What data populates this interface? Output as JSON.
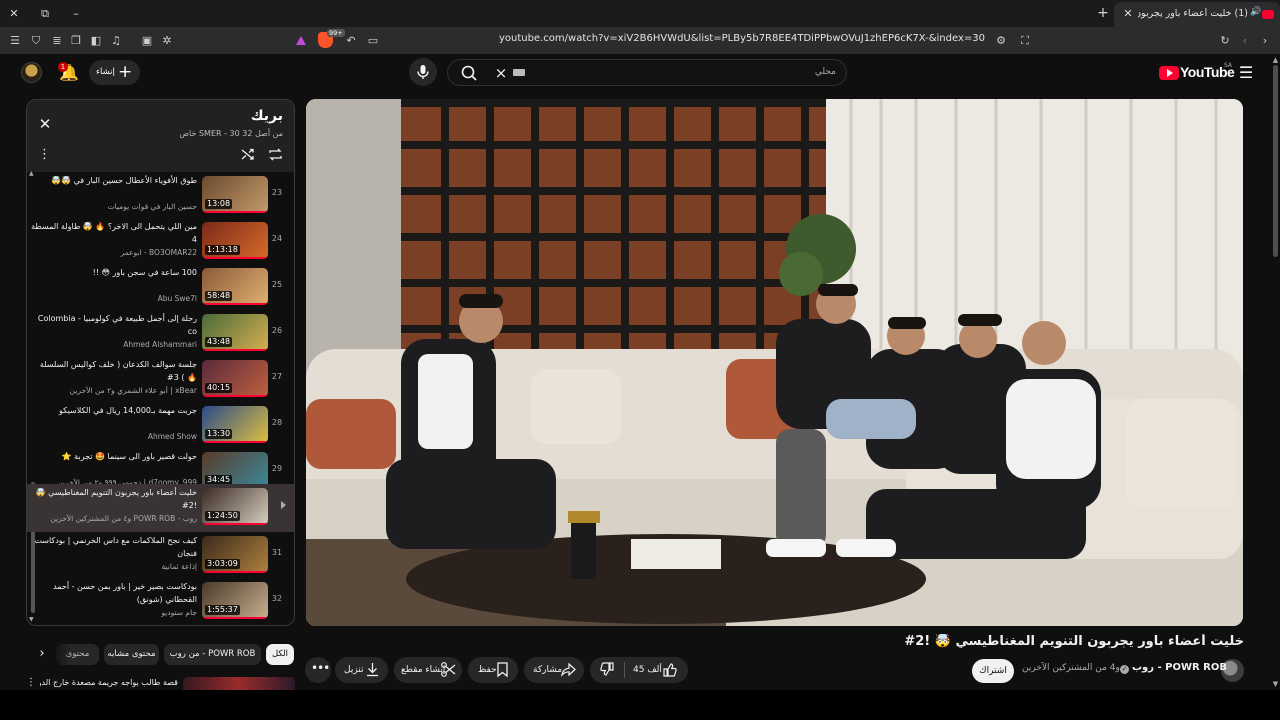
{
  "browser": {
    "tab_title": "(1) خليت أعضاء باور يجربون التنويم",
    "url": "youtube.com/watch?v=xiV2B6HVWdU&list=PLBy5b7R8EE4TDiPPbwOVuJ1zhEP6cK7X-&index=30",
    "brave_shields_count": "99+",
    "window_controls": {
      "close": "✕",
      "restore": "⧉",
      "minimize": "–"
    },
    "new_tab": "+",
    "tab_close": "✕"
  },
  "masthead": {
    "logo_text": "YouTube",
    "country_code": "SA",
    "search_placeholder": "محلي",
    "notifications_badge": "1",
    "create_label": "إنشاء"
  },
  "player": {
    "description": "video-frame"
  },
  "video": {
    "title": "خليت أعضاء باور يجربون التنويم المغناطيسي 🤯 !2#",
    "channel_name": "روب - POWR ROB",
    "subscribers": "و4 من المشتركين الآخرين",
    "subscribe_label": "اشتراك",
    "like_count": "45 ألف",
    "share_label": "مشاركة",
    "save_label": "حفظ",
    "clip_label": "إنشاء مقطع",
    "download_label": "تنزيل"
  },
  "playlist": {
    "title": "بريك",
    "subtitle": "خاص SMER - 30 من أصل 32",
    "items": [
      {
        "index": "23",
        "title": "طوق الأفوياء الأعطال حسين البار في 🤯🤯",
        "channel": "حسين البار في قوات يوميات",
        "duration": "13:08",
        "c1": "#6a4a2f",
        "c2": "#c49a6a"
      },
      {
        "index": "24",
        "title": "مين اللي يتحمل الى الاخر؟ 🔥 🤯 طاولة المسطة 4",
        "channel": "BO3OMAR22 - ابوعمر",
        "duration": "1:13:18",
        "c1": "#7a2a18",
        "c2": "#d86a2a"
      },
      {
        "index": "25",
        "title": "100 ساعة في سجن باور 😳 !!",
        "channel": "Abu Swe7l",
        "duration": "58:48",
        "c1": "#8a5a3a",
        "c2": "#e0b070"
      },
      {
        "index": "26",
        "title": "رحلة إلى أجمل طبيعة في كولومبيا - Colombia co",
        "channel": "Ahmed Alshammari",
        "duration": "43:48",
        "c1": "#4a6a3a",
        "c2": "#d6b050"
      },
      {
        "index": "27",
        "title": "جلسة سوالف الكدعان ( خلف كواليس السلسلة 🔥 ) 3#",
        "channel": "xBear | أبو علاء الشمري و٢ من الآخرين",
        "duration": "40:15",
        "c1": "#5a2a3a",
        "c2": "#c06040"
      },
      {
        "index": "28",
        "title": "جربت مهمة بـ14,000 ريال في الكلاسيكو",
        "channel": "Ahmed Show",
        "duration": "13:30",
        "c1": "#2a4a8a",
        "c2": "#e0c040"
      },
      {
        "index": "29",
        "title": "حولت قصير باور الى سينما 🤩 تجربة ⭐",
        "channel": "d7oomy_999 | دحومي ٩٩٩ و٢ من الآخرين",
        "duration": "34:45",
        "c1": "#5a3a2a",
        "c2": "#3a8a9a"
      },
      {
        "index": "30",
        "title": "خليت أعضاء باور يجربون التنويم المغناطيسي 🤯 !2#",
        "channel": "روب - POWR ROB و٤ من المشتركين الآخرين",
        "duration": "1:24:50",
        "c1": "#3a2a22",
        "c2": "#d8cfc2"
      },
      {
        "index": "31",
        "title": "كيف نجح الملاكمات مع داس الخرنمي | بودكاست فنجان",
        "channel": "إذاعة ثمانية",
        "duration": "3:03:09",
        "c1": "#3a2a1a",
        "c2": "#b08040"
      },
      {
        "index": "32",
        "title": "بودكاست بصير خير | باور بمن حسن - أحمد القحطاني (شونق)",
        "channel": "جام ستوديو",
        "duration": "1:55:37",
        "c1": "#4a3a2a",
        "c2": "#c8b090"
      }
    ]
  },
  "chips": {
    "all": "الكل",
    "from_channel": "من روب - POWR ROB",
    "similar": "محتوى مشابه",
    "other": "محتوى"
  },
  "recommendation": {
    "title": "قصة طالب يواجه جريمة مصعدة خارج الدولة ("
  },
  "colors": {
    "accent": "#ff0033",
    "background": "#0f0f0f",
    "surface": "#272727"
  }
}
